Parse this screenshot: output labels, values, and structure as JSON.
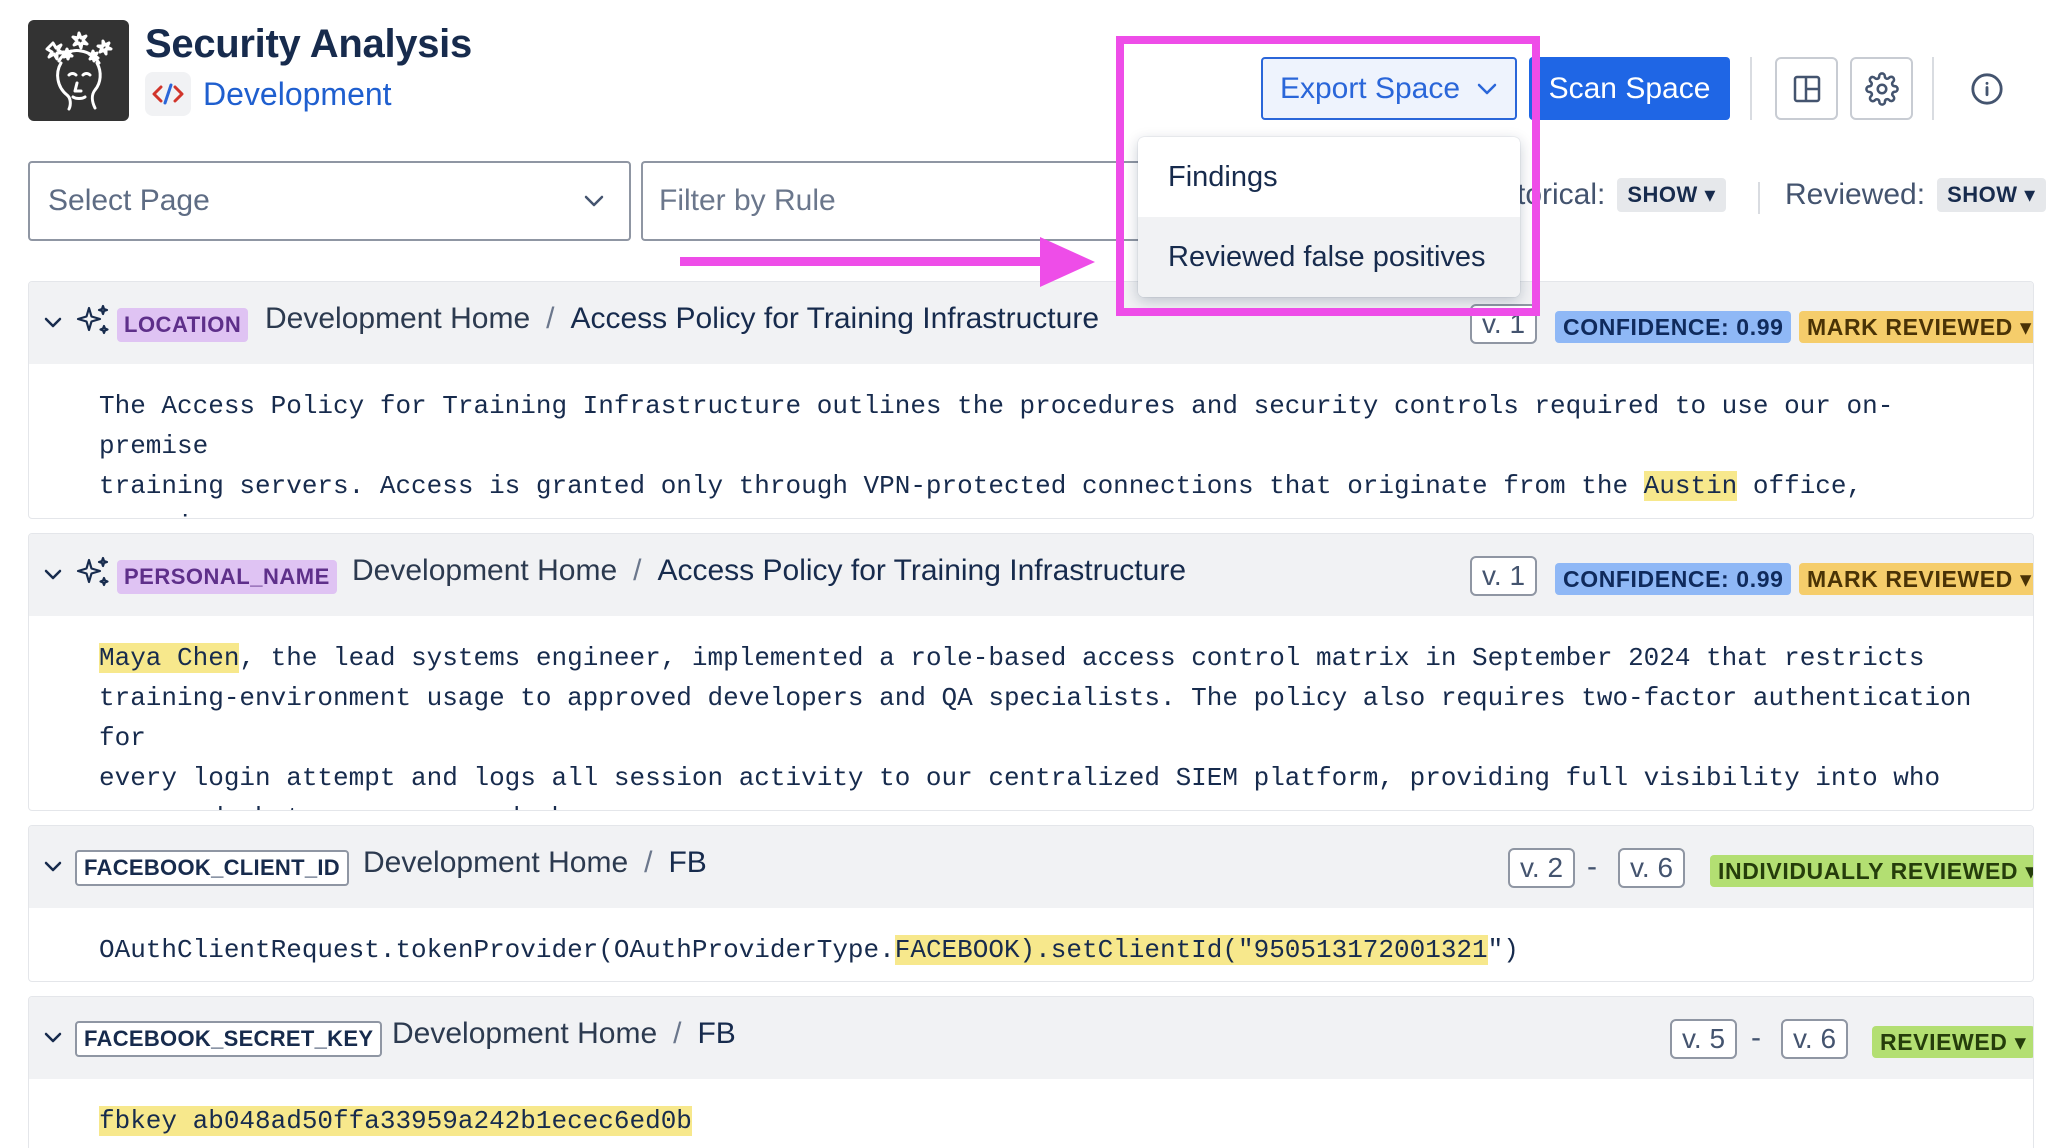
{
  "header": {
    "app_title": "Security Analysis",
    "space_name": "Development",
    "logo_icon": "face-with-sparkles-icon",
    "space_icon": "code-icon"
  },
  "toolbar": {
    "export_label": "Export Space",
    "scan_label": "Scan Space",
    "layout_icon": "layout-columns-icon",
    "settings_icon": "gear-icon",
    "info_icon": "info-icon"
  },
  "filters": {
    "select_page_placeholder": "Select Page",
    "filter_rule_placeholder": "Filter by Rule",
    "historical_label": "storical:",
    "historical_value": "SHOW",
    "reviewed_label": "Reviewed:",
    "reviewed_value": "SHOW"
  },
  "export_menu": {
    "items": [
      {
        "label": "Findings"
      },
      {
        "label": "Reviewed false positives"
      }
    ]
  },
  "annotation": {
    "highlight_color": "#ee4de8"
  },
  "findings": [
    {
      "rule": "LOCATION",
      "space": "Development Home",
      "page": "Access Policy for Training Infrastructure",
      "version": "v. 1",
      "confidence": "CONFIDENCE: 0.99",
      "status": "MARK REVIEWED",
      "body_before": "The Access Policy for Training Infrastructure outlines the procedures and security controls required to use our on-premise\ntraining servers. Access is granted only through VPN-protected connections that originate from the ",
      "body_match": "Austin",
      "body_after": " office, ensuring\nthat all activity can be monitored and audited within a single, secure network perimeter."
    },
    {
      "rule": "PERSONAL_NAME",
      "space": "Development Home",
      "page": "Access Policy for Training Infrastructure",
      "version": "v. 1",
      "confidence": "CONFIDENCE: 0.99",
      "status": "MARK REVIEWED",
      "body_before": "",
      "body_match": "Maya Chen",
      "body_after": ", the lead systems engineer, implemented a role-based access control matrix in September 2024 that restricts\ntraining-environment usage to approved developers and QA specialists. The policy also requires two-factor authentication for\nevery login attempt and logs all session activity to our centralized SIEM platform, providing full visibility into who\naccessed what resources and when."
    },
    {
      "rule": "FACEBOOK_CLIENT_ID",
      "space": "Development Home",
      "page": "FB",
      "version_from": "v. 2",
      "version_to": "v. 6",
      "dash": "-",
      "status": "INDIVIDUALLY REVIEWED",
      "body_before": "OAuthClientRequest.tokenProvider(OAuthProviderType.",
      "body_match": "FACEBOOK).setClientId(\"950513172001321",
      "body_after": "\")"
    },
    {
      "rule": "FACEBOOK_SECRET_KEY",
      "space": "Development Home",
      "page": "FB",
      "version_from": "v. 5",
      "version_to": "v. 6",
      "dash": "-",
      "status": "REVIEWED",
      "body_before": "",
      "body_match": "fbkey ab048ad50ffa33959a242b1ecec6ed0b",
      "body_after": ""
    }
  ]
}
